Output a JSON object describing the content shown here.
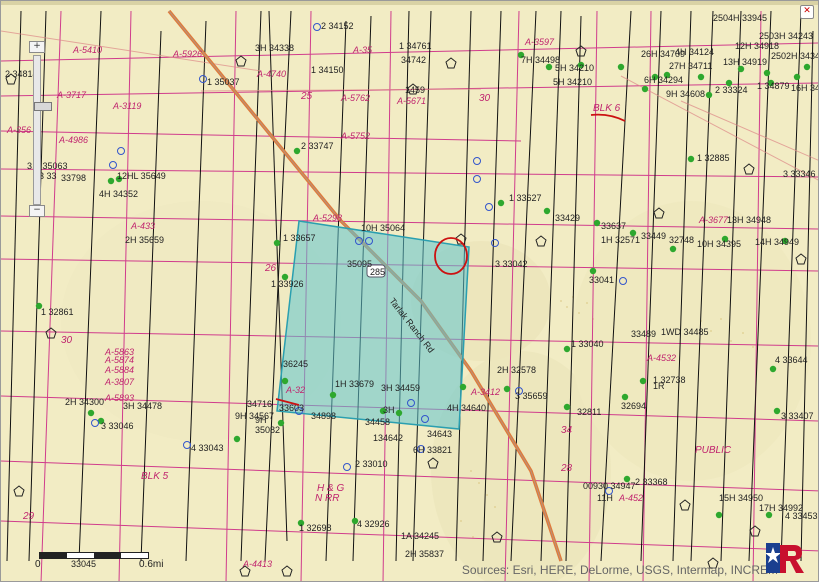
{
  "map": {
    "highway_route": "285",
    "road_name": "Tarlak Ranch Rd",
    "area_labels": [
      "A-5410",
      "A-5926",
      "A-35",
      "A-3717",
      "A-3119",
      "A-356",
      "A-4986",
      "A-5762",
      "A-5752",
      "A-5671",
      "A-3597",
      "A-5298",
      "A-4740",
      "A-433",
      "A-3677",
      "A-4532",
      "A-3412",
      "A-32",
      "A-4413",
      "A-452",
      "A-5863",
      "A-5874",
      "A-3807",
      "A-5884",
      "A-5893"
    ],
    "section_labels": [
      "25",
      "30",
      "26",
      "30",
      "29",
      "28",
      "34",
      "BLK 6",
      "BLK 5",
      "H & G",
      "N RR",
      "PUBLIC"
    ],
    "well_labels": [
      "2 34152",
      "3H 34338",
      "1 34150",
      "1 34761",
      "34742",
      "1459",
      "1 35037",
      "2 33747",
      "1 33657",
      "1 33926",
      "10H 35064",
      "35095",
      "1 32861",
      "36245",
      "1H 33679",
      "34898",
      "3H 34459",
      "34458",
      "134642",
      "3H",
      "6H 33821",
      "4H 34640",
      "34643",
      "2H 32578",
      "3 35659",
      "1 33040",
      "32811",
      "1 32738",
      "1R",
      "32694",
      "4 33644",
      "3 33407",
      "1WD 34485",
      "33489",
      "1 33627",
      "33429",
      "33637",
      "33449",
      "32748",
      "10H 34395",
      "13H 34948",
      "14H 34949",
      "1H 32571",
      "33041",
      "3 33042",
      "1 32885",
      "3 33346",
      "4H 34124",
      "26H 34709",
      "27H 34711",
      "6H 34294",
      "9H 34608",
      "2504H 33945",
      "12H 34918",
      "2503H 34243",
      "13H 34919",
      "2502H 34349",
      "16H 34765",
      "2 33324",
      "1 34879",
      "7H 34498",
      "5H 34210",
      "5H 34210",
      "2H 34300",
      "3 33046",
      "3H 34478",
      "4 33043",
      "9H 34567",
      "34716",
      "33603",
      "35082",
      "9H",
      "2 33010",
      "4 32926",
      "1 32698",
      "1A 34245",
      "2H 35837",
      "00930 34947",
      "11H",
      "2 33368",
      "15H 34950",
      "17H 34992",
      "4 33453",
      "33798",
      "12HL 35649",
      "4H 34352",
      "2H 35659",
      "1 35063",
      "2 34814",
      "3",
      "3 33",
      "33045"
    ]
  },
  "scale": {
    "zero": "0",
    "max": "0.6mi"
  },
  "attribution": "Sources: Esri, HERE, DeLorme, USGS, Intermap, INCREM",
  "controls": {
    "zoom_in": "+",
    "zoom_out": "−",
    "close": "✕"
  },
  "colors": {
    "background": "#f2ecc4",
    "parcel_line": "#d03c8c",
    "well_line": "#111111",
    "road": "#e07a3a",
    "selection_fill": "#5fc4d0",
    "well_dot": "#2ea82e",
    "annotation": "#cc1111"
  }
}
